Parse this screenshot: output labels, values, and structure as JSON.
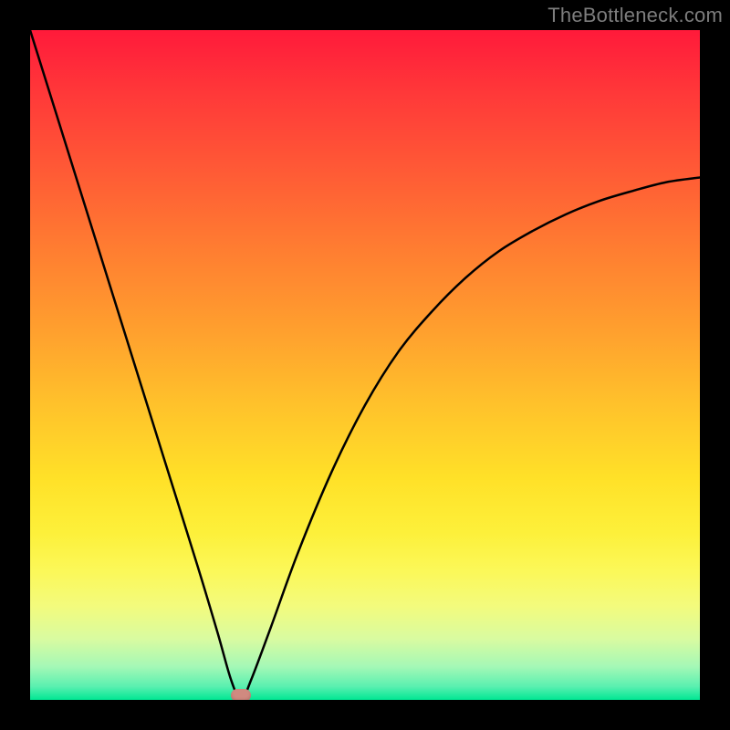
{
  "watermark": "TheBottleneck.com",
  "chart_data": {
    "type": "line",
    "title": "",
    "xlabel": "",
    "ylabel": "",
    "xlim": [
      0,
      100
    ],
    "ylim": [
      0,
      100
    ],
    "grid": false,
    "legend": false,
    "series": [
      {
        "name": "bottleneck-curve",
        "x": [
          0,
          5,
          10,
          15,
          20,
          25,
          28,
          30,
          31.5,
          33,
          36,
          40,
          45,
          50,
          55,
          60,
          65,
          70,
          75,
          80,
          85,
          90,
          95,
          100
        ],
        "y": [
          100,
          84,
          68,
          52,
          36,
          20,
          10,
          3,
          0,
          3,
          11,
          22,
          34,
          44,
          52,
          58,
          63,
          67,
          70,
          72.5,
          74.5,
          76,
          77.3,
          78
        ]
      }
    ],
    "marker": {
      "x": 31.5,
      "y": 0,
      "color": "#d08a80"
    },
    "background_gradient": {
      "direction": "vertical",
      "stops": [
        {
          "pos": 0,
          "color": "#ff1a3a"
        },
        {
          "pos": 50,
          "color": "#ffba2c"
        },
        {
          "pos": 80,
          "color": "#fbf85a"
        },
        {
          "pos": 100,
          "color": "#00e793"
        }
      ]
    }
  }
}
